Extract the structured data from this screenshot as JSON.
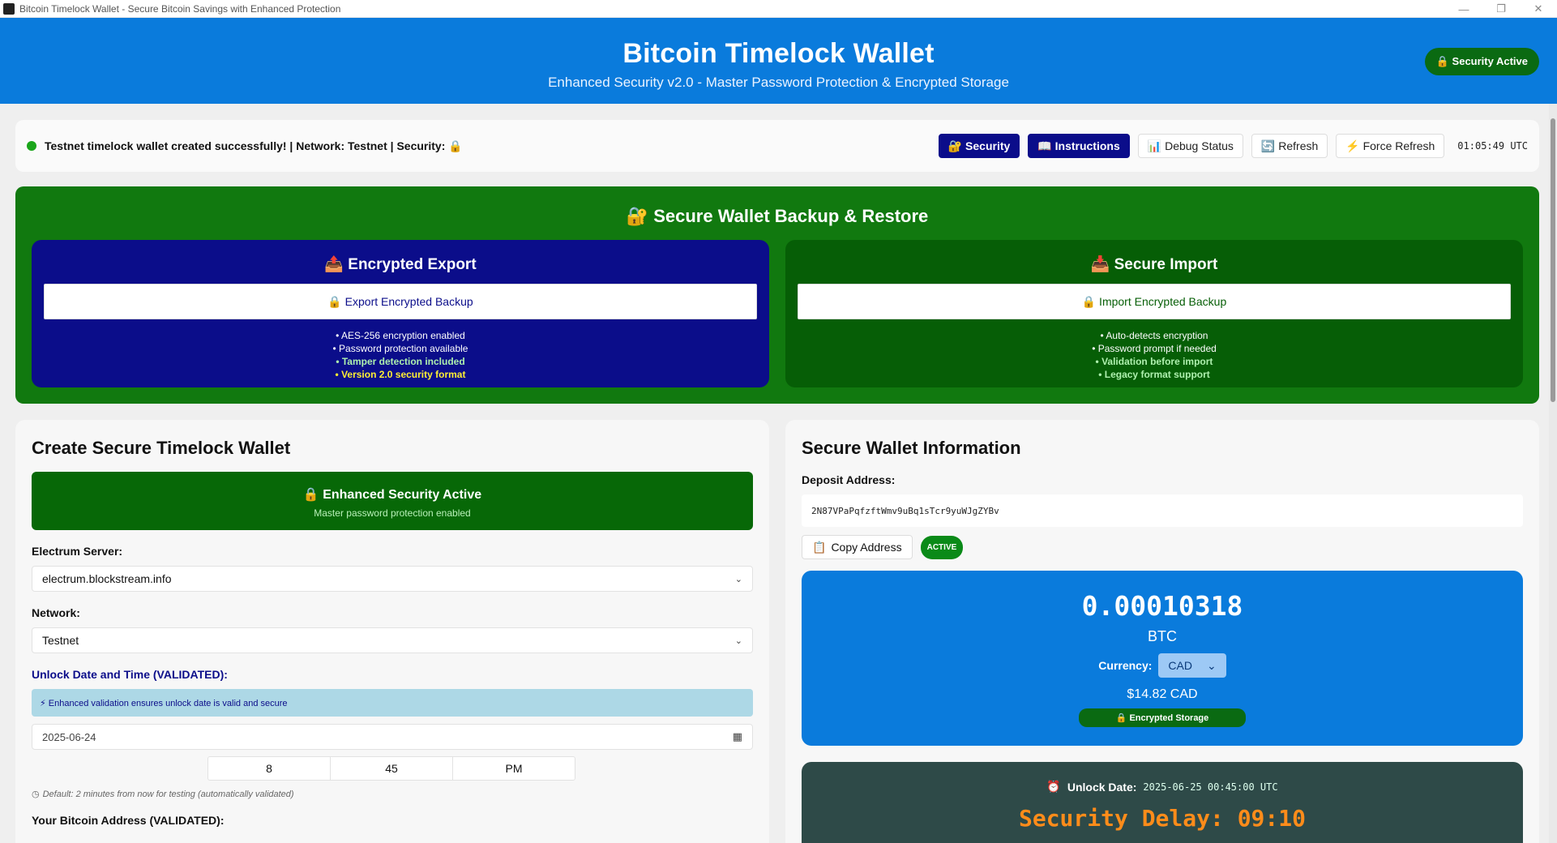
{
  "window": {
    "title": "Bitcoin Timelock Wallet - Secure Bitcoin Savings with Enhanced Protection",
    "controls": [
      "—",
      "❐",
      "✕"
    ]
  },
  "header": {
    "title": "Bitcoin Timelock Wallet",
    "subtitle": "Enhanced Security v2.0 - Master Password Protection & Encrypted Storage",
    "security_badge": "🔒 Security Active"
  },
  "status": {
    "message": "Testnet timelock wallet created successfully! | Network: Testnet | Security: 🔒",
    "buttons": {
      "security": "🔐 Security",
      "instructions": "📖 Instructions",
      "debug": "📊 Debug Status",
      "refresh": "🔄 Refresh",
      "force_refresh": "⚡ Force Refresh"
    },
    "clock": "01:05:49 UTC"
  },
  "backup": {
    "title": "🔐 Secure Wallet Backup & Restore",
    "export": {
      "title": "📤 Encrypted Export",
      "button": "🔒 Export Encrypted Backup",
      "features": [
        "• AES-256 encryption enabled",
        "• Password protection available",
        "• Tamper detection included",
        "• Version 2.0 security format"
      ]
    },
    "import": {
      "title": "📥 Secure Import",
      "button": "🔒 Import Encrypted Backup",
      "features": [
        "• Auto-detects encryption",
        "• Password prompt if needed",
        "• Validation before import",
        "• Legacy format support"
      ]
    }
  },
  "create": {
    "title": "Create Secure Timelock Wallet",
    "security_title": "🔒 Enhanced Security Active",
    "security_sub": "Master password protection enabled",
    "server_label": "Electrum Server:",
    "server_value": "electrum.blockstream.info",
    "network_label": "Network:",
    "network_value": "Testnet",
    "unlock_label": "Unlock Date and Time (VALIDATED):",
    "unlock_hint": "⚡ Enhanced validation ensures unlock date is valid and secure",
    "date_value": "2025-06-24",
    "hour": "8",
    "minute": "45",
    "ampm": "PM",
    "default_note": "Default: 2 minutes from now for testing (automatically validated)",
    "address_label": "Your Bitcoin Address (VALIDATED):"
  },
  "info": {
    "title": "Secure Wallet Information",
    "deposit_label": "Deposit Address:",
    "address": "2N87VPaPqfzftWmv9uBq1sTcr9yuWJgZYBv",
    "copy_button": "Copy Address",
    "active_badge": "ACTIVE",
    "balance": "0.00010318",
    "unit": "BTC",
    "currency_label": "Currency:",
    "currency": "CAD",
    "fiat_value": "$14.82 CAD",
    "storage_badge": "🔒 Encrypted Storage",
    "unlock_date_label": "Unlock Date:",
    "unlock_date_value": "2025-06-25 00:45:00 UTC",
    "delay": "Security Delay: 09:10"
  }
}
